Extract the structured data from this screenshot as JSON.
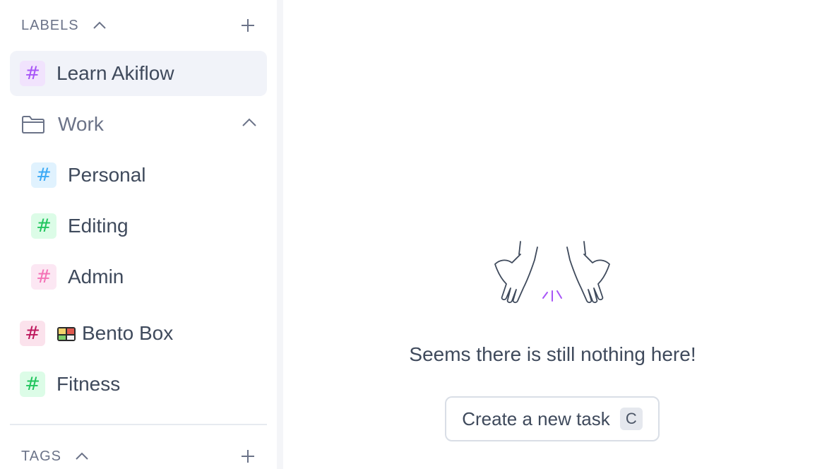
{
  "sidebar": {
    "labels_section": {
      "title": "LABELS"
    },
    "items": [
      {
        "label": "Learn Akiflow",
        "hash": "#",
        "color": "#a855f7",
        "bg": "#f1e3fd",
        "selected": true
      },
      {
        "label": "Bento Box",
        "hash": "#",
        "color": "#be185d",
        "bg": "#fbe2ec",
        "emoji": "bento-box-icon"
      },
      {
        "label": "Fitness",
        "hash": "#",
        "color": "#22c55e",
        "bg": "#dcfce7"
      }
    ],
    "folder": {
      "label": "Work",
      "children": [
        {
          "label": "Personal",
          "hash": "#",
          "color": "#3ba9f5",
          "bg": "#e0f2fe"
        },
        {
          "label": "Editing",
          "hash": "#",
          "color": "#22c55e",
          "bg": "#dcfce7"
        },
        {
          "label": "Admin",
          "hash": "#",
          "color": "#f472b6",
          "bg": "#fce7f3"
        }
      ]
    },
    "tags_section": {
      "title": "TAGS"
    }
  },
  "main": {
    "empty_message": "Seems there is still nothing here!",
    "create_button": {
      "label": "Create a new task",
      "shortcut": "C"
    }
  },
  "colors": {
    "accent": "#a855f7",
    "text": "#3f4a5c",
    "muted": "#6b7388",
    "selected_bg": "#f1f3f9"
  }
}
